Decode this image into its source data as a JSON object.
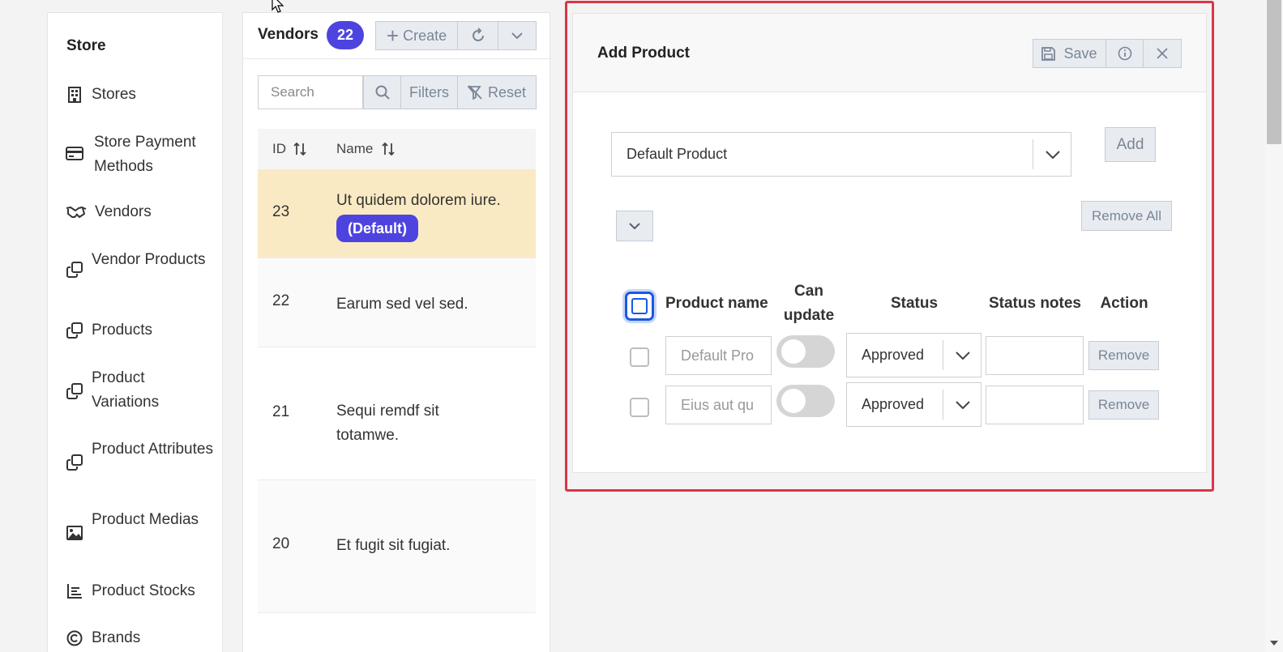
{
  "sidebar": {
    "title": "Store",
    "items": [
      {
        "label": "Stores",
        "icon": "building-icon"
      },
      {
        "label": "Store Payment Methods",
        "icon": "credit-card-icon"
      },
      {
        "label": "Vendors",
        "icon": "handshake-icon"
      },
      {
        "label": "Vendor Products",
        "icon": "copy-icon"
      },
      {
        "label": "Products",
        "icon": "copy-icon"
      },
      {
        "label": "Product Variations",
        "icon": "copy-icon"
      },
      {
        "label": "Product Attributes",
        "icon": "copy-icon"
      },
      {
        "label": "Product Medias",
        "icon": "image-icon"
      },
      {
        "label": "Product Stocks",
        "icon": "bar-chart-icon"
      },
      {
        "label": "Brands",
        "icon": "copyright-icon"
      }
    ]
  },
  "vendors": {
    "title": "Vendors",
    "count": "22",
    "create_label": "Create",
    "search_placeholder": "Search",
    "filters_label": "Filters",
    "reset_label": "Reset",
    "columns": [
      "ID",
      "Name"
    ],
    "rows": [
      {
        "id": "23",
        "name": "Ut quidem dolorem iure.",
        "badge": "(Default)",
        "selected": true
      },
      {
        "id": "22",
        "name": "Earum sed vel sed."
      },
      {
        "id": "21",
        "name": "Sequi remdf sit totamwe."
      },
      {
        "id": "20",
        "name": "Et fugit sit fugiat."
      }
    ]
  },
  "add_product": {
    "title": "Add Product",
    "save_label": "Save",
    "product_select_value": "Default Product",
    "add_label": "Add",
    "remove_all_label": "Remove All",
    "columns": {
      "product_name": "Product name",
      "can_update": "Can update",
      "status": "Status",
      "status_notes": "Status notes",
      "action": "Action"
    },
    "rows": [
      {
        "product_name": "Default Pro",
        "can_update": false,
        "status": "Approved",
        "status_notes": "",
        "action": "Remove"
      },
      {
        "product_name": "Eius aut qu",
        "can_update": false,
        "status": "Approved",
        "status_notes": "",
        "action": "Remove"
      }
    ]
  },
  "colors": {
    "accent": "#4d44e0",
    "highlight_row": "#faeac3",
    "focus_border": "#dc3545",
    "checkbox_focus": "#1c57e0"
  }
}
